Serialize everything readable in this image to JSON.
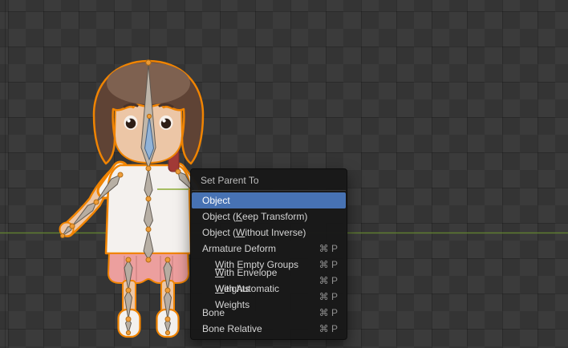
{
  "viewport": {
    "colors": {
      "accent_orange": "#f08402",
      "selection_blue": "#4772b3",
      "axis_green": "#5f7d30",
      "menu_bg": "#1a1a1a",
      "checker_dark": "#343434",
      "checker_light": "#3b3b3b"
    }
  },
  "menu": {
    "title": "Set Parent To",
    "items": [
      {
        "id": "object",
        "pre": "Object",
        "u": "",
        "post": "",
        "shortcut": "",
        "selected": true,
        "indent": 0
      },
      {
        "id": "object-keep-transform",
        "pre": "Object (",
        "u": "K",
        "post": "eep Transform)",
        "shortcut": "",
        "selected": false,
        "indent": 0
      },
      {
        "id": "object-without-inverse",
        "pre": "Object (",
        "u": "W",
        "post": "ithout Inverse)",
        "shortcut": "",
        "selected": false,
        "indent": 0
      },
      {
        "id": "armature-deform",
        "pre": "Armature Deform",
        "u": "",
        "post": "",
        "shortcut": "⌘ P",
        "selected": false,
        "indent": 0
      },
      {
        "id": "with-empty-groups",
        "pre": "",
        "u": "W",
        "post": "ith Empty Groups",
        "shortcut": "⌘ P",
        "selected": false,
        "indent": 1
      },
      {
        "id": "with-envelope-weights",
        "pre": "",
        "u": "W",
        "post": "ith Envelope Weights",
        "shortcut": "⌘ P",
        "selected": false,
        "indent": 1
      },
      {
        "id": "with-automatic-weights",
        "pre": "",
        "u": "W",
        "post": "ith Automatic Weights",
        "shortcut": "⌘ P",
        "selected": false,
        "indent": 1
      },
      {
        "id": "bone",
        "pre": "Bone",
        "u": "",
        "post": "",
        "shortcut": "⌘ P",
        "selected": false,
        "indent": 0
      },
      {
        "id": "bone-relative",
        "pre": "Bone Relative",
        "u": "",
        "post": "",
        "shortcut": "⌘ P",
        "selected": false,
        "indent": 0
      }
    ]
  }
}
